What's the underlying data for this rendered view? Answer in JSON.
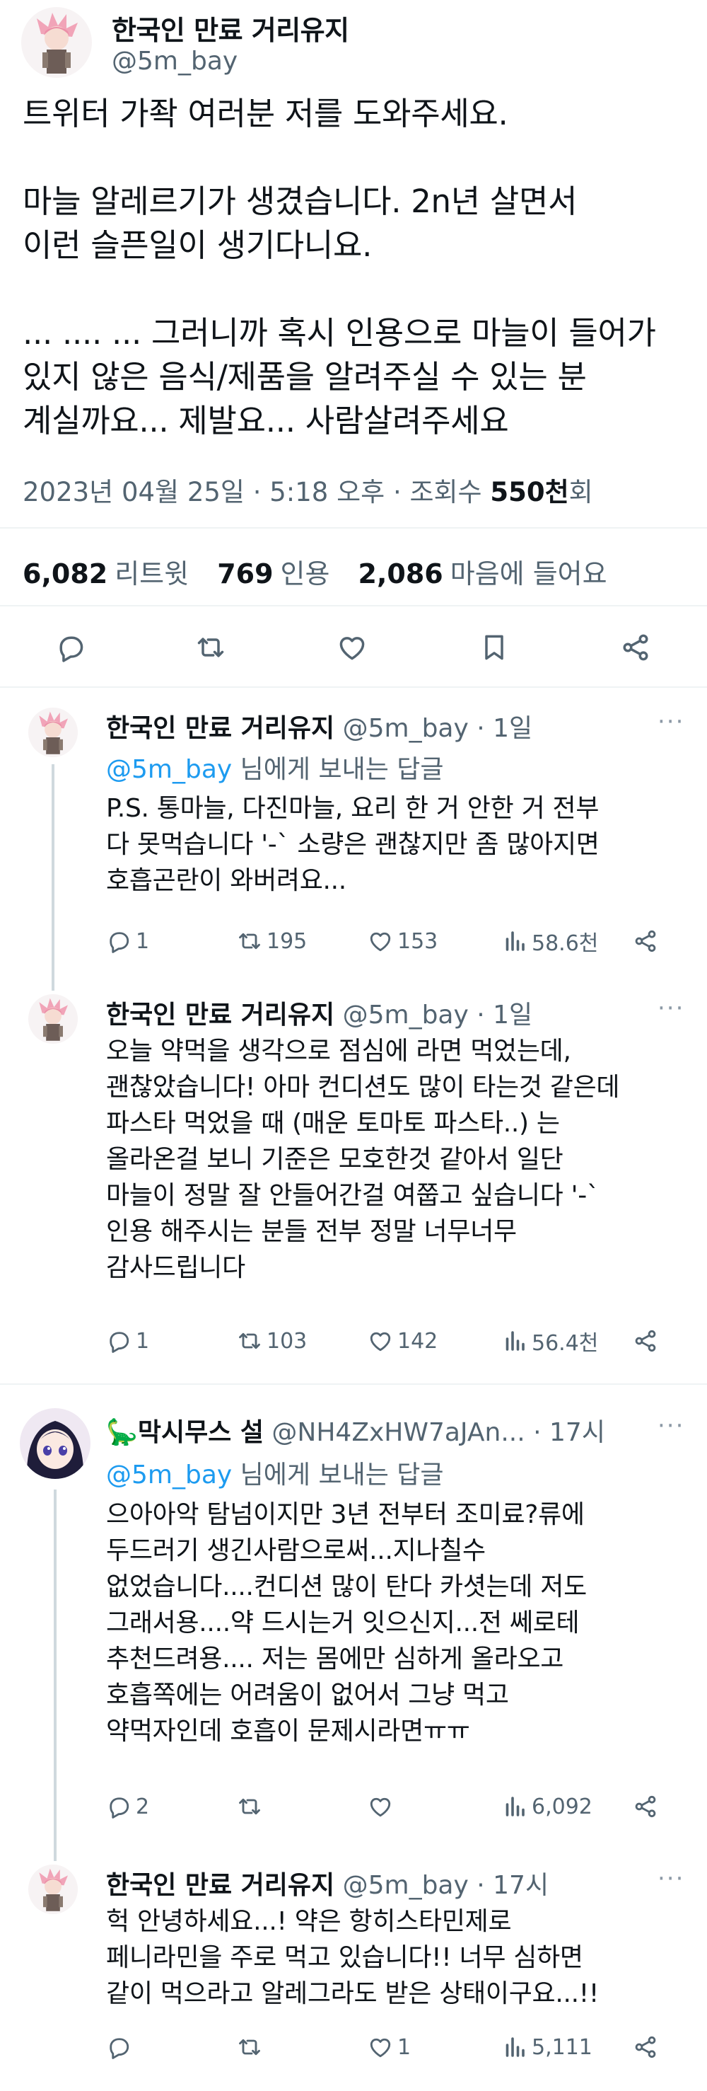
{
  "main_tweet": {
    "display_name": "한국인 만료 거리유지",
    "handle": "@5m_bay",
    "body": "트위터 가좍 여러분 저를 도와주세요.\n\n마늘 알레르기가 생겼습니다. 2n년 살면서\n이런 슬픈일이 생기다니요.\n\n... .... ... 그러니까 혹시 인용으로 마늘이 들어가\n있지 않은 음식/제품을 알려주실 수 있는 분\n계실까요... 제발요... 사람살려주세요",
    "timestamp": "2023년 04월 25일 · 5:18 오후 · 조회수 ",
    "view_count": "550천",
    "view_suffix": "회",
    "stats": {
      "retweets": "6,082",
      "retweets_label": "리트윗",
      "quotes": "769",
      "quotes_label": "인용",
      "likes": "2,086",
      "likes_label": "마음에 들어요"
    }
  },
  "replies": [
    {
      "display_name": "한국인 만료 거리유지",
      "meta": "@5m_bay · 1일",
      "more": "···",
      "reply_to_link": "@5m_bay",
      "reply_to_suffix": " 님에게 보내는 답글",
      "body": "P.S. 통마늘, 다진마늘, 요리 한 거 안한 거 전부\n다 못먹습니다 '-` 소량은 괜찮지만 좀 많아지면\n호흡곤란이 와버려요...",
      "replies": "1",
      "retweets": "195",
      "likes": "153",
      "views": "58.6천"
    },
    {
      "display_name": "한국인 만료 거리유지",
      "meta": "@5m_bay · 1일",
      "more": "···",
      "body": "오늘 약먹을 생각으로 점심에 라면 먹었는데,\n괜찮았습니다! 아마 컨디션도 많이 타는것 같은데\n파스타 먹었을 때 (매운 토마토 파스타..) 는\n올라온걸 보니 기준은 모호한것 같아서 일단\n마늘이 정말 잘 안들어간걸 여쭙고 싶습니다 '-`\n인용 해주시는 분들 전부 정말 너무너무\n감사드립니다",
      "replies": "1",
      "retweets": "103",
      "likes": "142",
      "views": "56.4천"
    },
    {
      "display_name": "🦕막시무스 설",
      "meta": "@NH4ZxHW7aJAn... · 17시",
      "more": "···",
      "reply_to_link": "@5m_bay",
      "reply_to_suffix": " 님에게 보내는 답글",
      "body": "으아아악 탐넘이지만 3년 전부터 조미료?류에\n두드러기 생긴사람으로써...지나칠수\n없었습니다....컨디션 많이 탄다 카셧는데 저도\n그래서용....약 드시는거 잇으신지...전 쎄로테\n추천드려용.... 저는 몸에만 심하게 올라오고\n호흡쪽에는 어려움이 없어서 그냥 먹고\n약먹자인데 호흡이 문제시라면ㅠㅠ",
      "replies": "2",
      "retweets": "",
      "likes": "",
      "views": "6,092"
    },
    {
      "display_name": "한국인 만료 거리유지",
      "meta": "@5m_bay · 17시",
      "more": "···",
      "body": "헉 안녕하세요...! 약은 항히스타민제로\n페니라민을 주로 먹고 있습니다!! 너무 심하면\n같이 먹으라고 알레그라도 받은 상태이구요...!!",
      "replies": "",
      "retweets": "",
      "likes": "1",
      "views": "5,111"
    }
  ],
  "colors": {
    "text": "#0f1419",
    "secondary": "#536471",
    "link": "#1d9bf0",
    "divider": "#eff3f4",
    "thread_line": "#cfd9de"
  },
  "icons": [
    "reply-icon",
    "retweet-icon",
    "like-icon",
    "bookmark-icon",
    "share-icon",
    "views-icon",
    "more-icon"
  ]
}
